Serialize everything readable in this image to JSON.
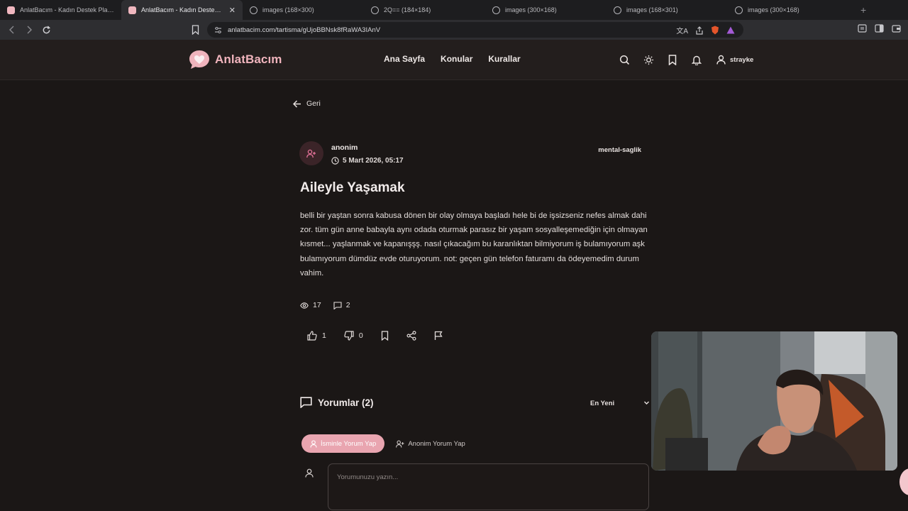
{
  "browser": {
    "tabs": [
      {
        "label": "AnlatBacım - Kadın Destek Platformu",
        "favicon": "pink-chat-favicon",
        "active": false,
        "closable": false
      },
      {
        "label": "AnlatBacım - Kadın Destek Platformu",
        "favicon": "pink-chat-favicon",
        "active": true,
        "closable": true
      },
      {
        "label": "images (168×300)",
        "favicon": "globe-icon",
        "active": false,
        "closable": false
      },
      {
        "label": "2Q== (184×184)",
        "favicon": "globe-icon",
        "active": false,
        "closable": false
      },
      {
        "label": "images (300×168)",
        "favicon": "globe-icon",
        "active": false,
        "closable": false
      },
      {
        "label": "images (168×301)",
        "favicon": "globe-icon",
        "active": false,
        "closable": false
      },
      {
        "label": "images (300×168)",
        "favicon": "globe-icon",
        "active": false,
        "closable": false
      }
    ],
    "new_tab": "+",
    "url": "anlatbacim.com/tartisma/gUjoBBNsk8fRaWA3IAnV"
  },
  "site": {
    "brand": "AnlatBacım",
    "nav": [
      "Ana Sayfa",
      "Konular",
      "Kurallar"
    ],
    "username": "strayke",
    "accent_color": "#f0b4bd"
  },
  "post": {
    "back_label": "Geri",
    "author": "anonim",
    "date": "5 Mart 2026, 05:17",
    "category": "mental-saglik",
    "title": "Aileyle Yaşamak",
    "body": "belli bir yaştan sonra kabusa dönen bir olay olmaya başladı hele bi de işsizseniz nefes almak dahi zor. tüm gün anne babayla aynı odada oturmak parasız bir yaşam sosyalleşemediğin için olmayan kısmet... yaşlanmak ve kapanışşş. nasıl çıkacağım bu karanlıktan bilmiyorum iş bulamıyorum aşk bulamıyorum dümdüz evde oturuyorum. not: geçen gün telefon faturamı da ödeyemedim durum vahim.",
    "views": "17",
    "comment_count": "2",
    "likes": "1",
    "dislikes": "0"
  },
  "comments": {
    "heading": "Yorumlar (2)",
    "sort_selected": "En Yeni",
    "mode_named": "İsminle Yorum Yap",
    "mode_anonymous": "Anonim Yorum Yap",
    "placeholder": "Yorumunuzu yazın..."
  }
}
